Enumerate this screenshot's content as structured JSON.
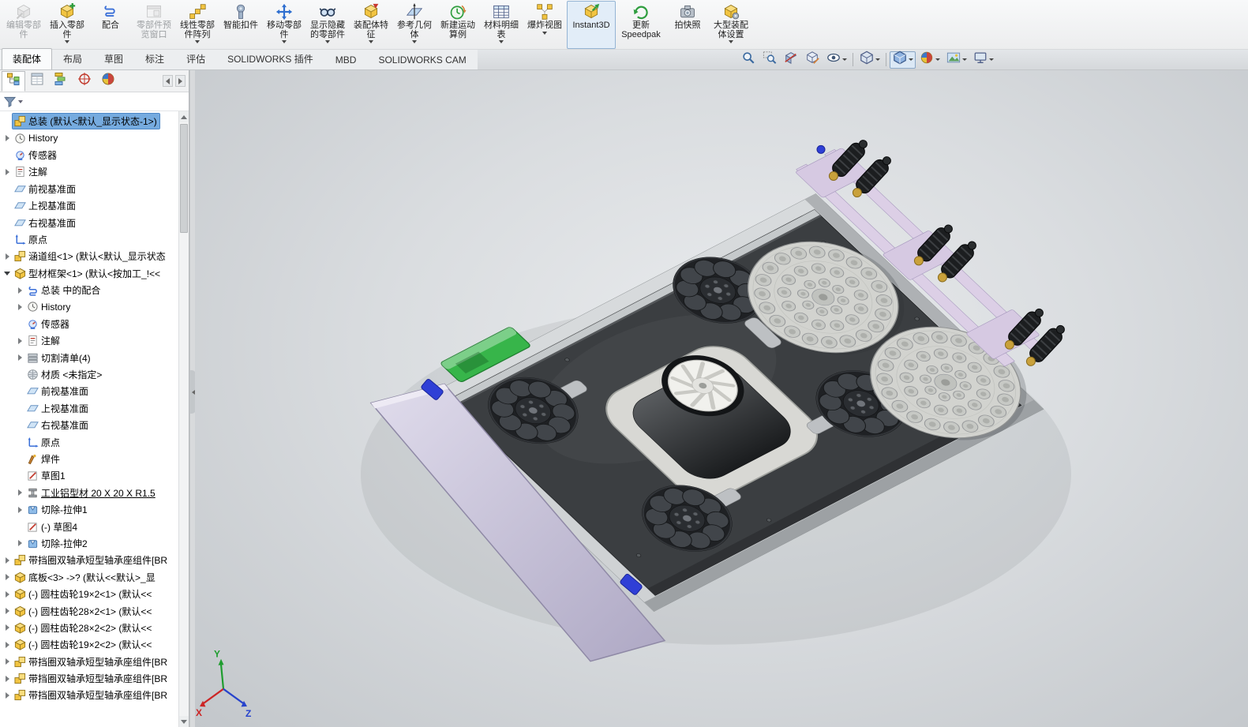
{
  "ribbon": {
    "buttons": [
      {
        "name": "edit-component",
        "label": "编辑零部件",
        "disabled": true,
        "dropdown": false
      },
      {
        "name": "insert-components",
        "label": "插入零部件",
        "dropdown": true
      },
      {
        "name": "mate",
        "label": "配合",
        "dropdown": false
      },
      {
        "name": "component-preview-window",
        "label": "零部件预览窗口",
        "disabled": true,
        "dropdown": false
      },
      {
        "name": "linear-component-pattern",
        "label": "线性零部件阵列",
        "dropdown": true
      },
      {
        "name": "smart-fasteners",
        "label": "智能扣件",
        "dropdown": false
      },
      {
        "name": "move-component",
        "label": "移动零部件",
        "dropdown": true
      },
      {
        "name": "show-hidden-components",
        "label": "显示隐藏的零部件",
        "dropdown": true
      },
      {
        "name": "assembly-features",
        "label": "装配体特征",
        "dropdown": true
      },
      {
        "name": "reference-geometry",
        "label": "参考几何体",
        "dropdown": true
      },
      {
        "name": "new-motion-study",
        "label": "新建运动算例",
        "dropdown": false
      },
      {
        "name": "bill-of-materials",
        "label": "材料明细表",
        "dropdown": true
      },
      {
        "name": "exploded-view",
        "label": "爆炸视图",
        "dropdown": true
      },
      {
        "name": "instant3d",
        "label": "Instant3D",
        "active": true,
        "dropdown": false
      },
      {
        "name": "update-speedpak",
        "label": "更新 Speedpak",
        "dropdown": false
      },
      {
        "name": "take-snapshot",
        "label": "拍快照",
        "dropdown": false
      },
      {
        "name": "large-assembly-settings",
        "label": "大型装配体设置",
        "dropdown": true
      }
    ]
  },
  "command_tabs": {
    "items": [
      {
        "label": "装配体",
        "active": true
      },
      {
        "label": "布局"
      },
      {
        "label": "草图"
      },
      {
        "label": "标注"
      },
      {
        "label": "评估"
      },
      {
        "label": "SOLIDWORKS 插件"
      },
      {
        "label": "MBD"
      },
      {
        "label": "SOLIDWORKS CAM"
      }
    ]
  },
  "headsup": {
    "items": [
      {
        "icon": "zoom-to-fit"
      },
      {
        "icon": "zoom-to-area"
      },
      {
        "icon": "section-view"
      },
      {
        "icon": "3d-drawing-view"
      },
      {
        "icon": "hide-show-items",
        "dropdown": true
      },
      {
        "sep": true
      },
      {
        "icon": "view-orientation",
        "dropdown": true
      },
      {
        "sep": true
      },
      {
        "icon": "display-style",
        "dropdown": true,
        "active": true
      },
      {
        "icon": "edit-appearance",
        "dropdown": true
      },
      {
        "icon": "apply-scene",
        "dropdown": true
      },
      {
        "icon": "view-settings",
        "dropdown": true
      }
    ]
  },
  "panel": {
    "tabs": [
      {
        "icon": "featuremanager",
        "active": true
      },
      {
        "icon": "propertymanager"
      },
      {
        "icon": "configurationmanager"
      },
      {
        "icon": "dimxpertmanager"
      },
      {
        "icon": "displaymanager"
      }
    ]
  },
  "tree": {
    "items": [
      {
        "indent": 0,
        "arrow": "none",
        "icon": "assembly",
        "label": "总装 (默认<默认_显示状态-1>)",
        "selected": true
      },
      {
        "indent": 0,
        "arrow": "right",
        "icon": "history",
        "label": "History"
      },
      {
        "indent": 0,
        "arrow": "none",
        "icon": "sensors",
        "label": "传感器"
      },
      {
        "indent": 0,
        "arrow": "right",
        "icon": "annotations",
        "label": "注解"
      },
      {
        "indent": 0,
        "arrow": "none",
        "icon": "plane",
        "label": "前视基准面"
      },
      {
        "indent": 0,
        "arrow": "none",
        "icon": "plane",
        "label": "上视基准面"
      },
      {
        "indent": 0,
        "arrow": "none",
        "icon": "plane",
        "label": "右视基准面"
      },
      {
        "indent": 0,
        "arrow": "none",
        "icon": "origin",
        "label": "原点"
      },
      {
        "indent": 0,
        "arrow": "right",
        "icon": "assembly",
        "label": "涵道组<1> (默认<默认_显示状态"
      },
      {
        "indent": 0,
        "arrow": "down",
        "icon": "part",
        "label": "型材框架<1> (默认<按加工_!<<"
      },
      {
        "indent": 1,
        "arrow": "right",
        "icon": "mates",
        "label": "总装 中的配合"
      },
      {
        "indent": 1,
        "arrow": "right",
        "icon": "history",
        "label": "History"
      },
      {
        "indent": 1,
        "arrow": "none",
        "icon": "sensors",
        "label": "传感器"
      },
      {
        "indent": 1,
        "arrow": "right",
        "icon": "annotations",
        "label": "注解"
      },
      {
        "indent": 1,
        "arrow": "right",
        "icon": "cutlist",
        "label": "切割清单(4)"
      },
      {
        "indent": 1,
        "arrow": "none",
        "icon": "material",
        "label": "材质 <未指定>"
      },
      {
        "indent": 1,
        "arrow": "none",
        "icon": "plane",
        "label": "前视基准面"
      },
      {
        "indent": 1,
        "arrow": "none",
        "icon": "plane",
        "label": "上视基准面"
      },
      {
        "indent": 1,
        "arrow": "none",
        "icon": "plane",
        "label": "右视基准面"
      },
      {
        "indent": 1,
        "arrow": "none",
        "icon": "origin",
        "label": "原点"
      },
      {
        "indent": 1,
        "arrow": "none",
        "icon": "weldment",
        "label": "焊件"
      },
      {
        "indent": 1,
        "arrow": "none",
        "icon": "sketch",
        "label": "草图1"
      },
      {
        "indent": 1,
        "arrow": "right",
        "icon": "structural",
        "label": "工业铝型材 20 X 20 X R1.5",
        "underline": true
      },
      {
        "indent": 1,
        "arrow": "right",
        "icon": "cut-extrude",
        "label": "切除-拉伸1"
      },
      {
        "indent": 1,
        "arrow": "none",
        "icon": "sketch",
        "label": "(-) 草图4"
      },
      {
        "indent": 1,
        "arrow": "right",
        "icon": "cut-extrude",
        "label": "切除-拉伸2"
      },
      {
        "indent": 0,
        "arrow": "right",
        "icon": "assembly",
        "label": "带挡圈双轴承短型轴承座组件[BR"
      },
      {
        "indent": 0,
        "arrow": "right",
        "icon": "part",
        "label": "底板<3> ->? (默认<<默认>_显"
      },
      {
        "indent": 0,
        "arrow": "right",
        "icon": "part",
        "label": "(-) 圆柱齿轮19×2<1> (默认<<"
      },
      {
        "indent": 0,
        "arrow": "right",
        "icon": "part",
        "label": "(-) 圆柱齿轮28×2<1> (默认<<"
      },
      {
        "indent": 0,
        "arrow": "right",
        "icon": "part",
        "label": "(-) 圆柱齿轮28×2<2> (默认<<"
      },
      {
        "indent": 0,
        "arrow": "right",
        "icon": "part",
        "label": "(-) 圆柱齿轮19×2<2> (默认<<"
      },
      {
        "indent": 0,
        "arrow": "right",
        "icon": "assembly",
        "label": "带挡圈双轴承短型轴承座组件[BR"
      },
      {
        "indent": 0,
        "arrow": "right",
        "icon": "assembly",
        "label": "带挡圈双轴承短型轴承座组件[BR"
      },
      {
        "indent": 0,
        "arrow": "right",
        "icon": "assembly",
        "label": "带挡圈双轴承短型轴承座组件[BR"
      }
    ]
  },
  "viewport": {
    "triad": {
      "x": "X",
      "y": "Y",
      "z": "Z"
    },
    "colors": {
      "selection": "#76abdf",
      "plate": "#3b3e41",
      "rails": "#c6c9cb",
      "disc": "#d2d3cf",
      "wheel": "#1f2124",
      "duct": "#d8d8d4",
      "fan": "#f1f1ed",
      "green_part": "#37b54a",
      "pink_frame": "#dccfe6",
      "ramp": "#cac4da",
      "clip_blue": "#2f3fd6"
    }
  }
}
